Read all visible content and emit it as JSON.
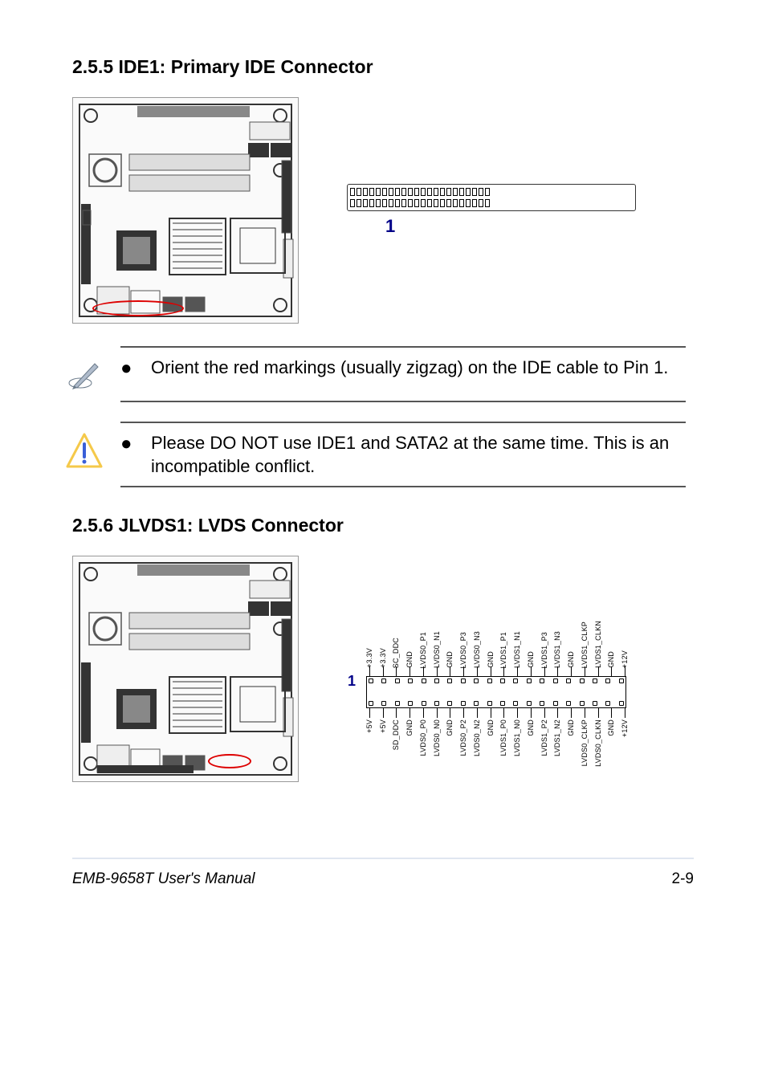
{
  "section1": {
    "title": "2.5.5 IDE1: Primary IDE Connector",
    "pin1_label": "1"
  },
  "note1": {
    "text": "Orient the red markings (usually zigzag) on the IDE cable to Pin 1."
  },
  "note2": {
    "text": "Please DO NOT use IDE1 and SATA2 at the same time. This is an incompatible conflict."
  },
  "section2": {
    "title": "2.5.6 JLVDS1: LVDS Connector",
    "pin1_label": "1",
    "top_labels": [
      "+3.3V",
      "+3.3V",
      "SC_DDC",
      "GND",
      "LVDS0_P1",
      "LVDS0_N1",
      "GND",
      "LVDS0_P3",
      "LVDS0_N3",
      "GND",
      "LVDS1_P1",
      "LVDS1_N1",
      "GND",
      "LVDS1_P3",
      "LVDS1_N3",
      "GND",
      "LVDS1_CLKP",
      "LVDS1_CLKN",
      "GND",
      "+12V"
    ],
    "bottom_labels": [
      "+5V",
      "+5V",
      "SD_DDC",
      "GND",
      "LVDS0_P0",
      "LVDS0_N0",
      "GND",
      "LVDS0_P2",
      "LVDS0_N2",
      "GND",
      "LVDS1_P0",
      "LVDS1_N0",
      "GND",
      "LVDS1_P2",
      "LVDS1_N2",
      "GND",
      "LVDS0_CLKP",
      "LVDS0_CLKN",
      "GND",
      "+12V"
    ]
  },
  "footer": {
    "left": "EMB-9658T User's Manual",
    "right": "2-9"
  }
}
